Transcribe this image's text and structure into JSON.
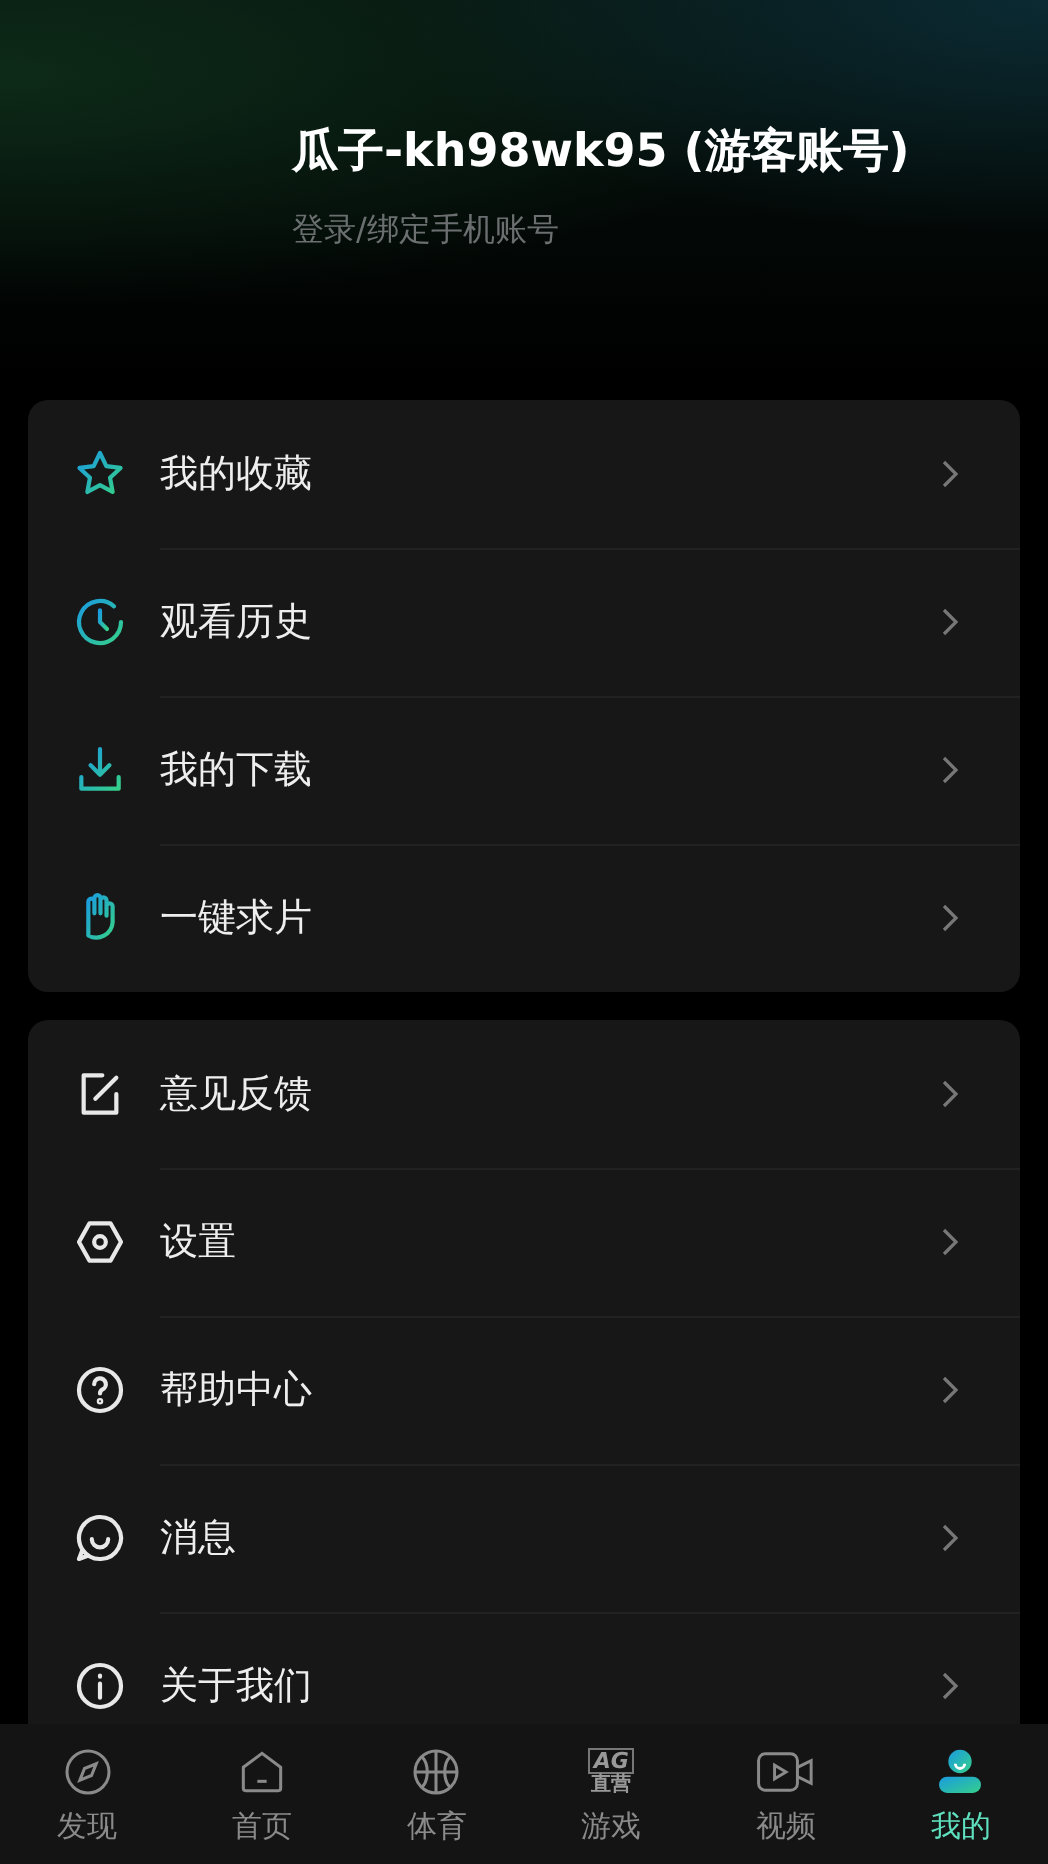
{
  "profile": {
    "name": "瓜子-kh98wk95 (游客账号)",
    "subtitle": "登录/绑定手机账号"
  },
  "groups": [
    {
      "items": [
        {
          "label": "我的收藏"
        },
        {
          "label": "观看历史"
        },
        {
          "label": "我的下载"
        },
        {
          "label": "一键求片"
        }
      ]
    },
    {
      "items": [
        {
          "label": "意见反馈"
        },
        {
          "label": "设置"
        },
        {
          "label": "帮助中心"
        },
        {
          "label": "消息"
        },
        {
          "label": "关于我们"
        }
      ]
    }
  ],
  "tabs": [
    {
      "label": "发现",
      "selected": false
    },
    {
      "label": "首页",
      "selected": false
    },
    {
      "label": "体育",
      "selected": false
    },
    {
      "label": "游戏",
      "badge": [
        "AG",
        "直营"
      ],
      "selected": false
    },
    {
      "label": "视频",
      "selected": false
    },
    {
      "label": "我的",
      "selected": true
    }
  ]
}
